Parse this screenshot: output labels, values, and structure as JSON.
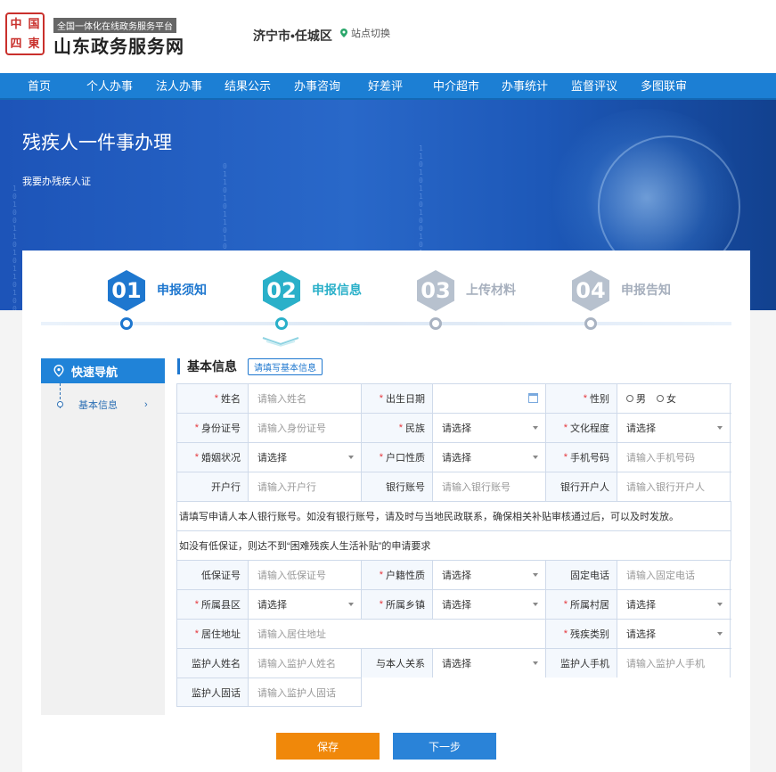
{
  "header": {
    "seal_chars": [
      "中",
      "国",
      "四",
      "東"
    ],
    "platform_label": "全国一体化在线政务服务平台",
    "site_title": "山东政务服务网",
    "region": "济宁市•任城区",
    "switch_label": "站点切换"
  },
  "nav": [
    "首页",
    "个人办事",
    "法人办事",
    "结果公示",
    "办事咨询",
    "好差评",
    "中介超市",
    "办事统计",
    "监督评议",
    "多图联审"
  ],
  "banner": {
    "title": "残疾人一件事办理",
    "subtitle": "我要办残疾人证"
  },
  "steps": [
    {
      "num": "01",
      "label": "申报须知",
      "state": "done",
      "color": "#1e77cf"
    },
    {
      "num": "02",
      "label": "申报信息",
      "state": "active",
      "color": "#2ab0c9"
    },
    {
      "num": "03",
      "label": "上传材料",
      "state": "todo",
      "color": "#b7c1ce"
    },
    {
      "num": "04",
      "label": "申报告知",
      "state": "todo",
      "color": "#b7c1ce"
    }
  ],
  "sidebar": {
    "title": "快速导航",
    "item": "基本信息"
  },
  "section": {
    "title": "基本信息",
    "tag": "请填写基本信息"
  },
  "form": {
    "name": {
      "label": "姓名",
      "placeholder": "请输入姓名"
    },
    "birth": {
      "label": "出生日期"
    },
    "gender": {
      "label": "性别",
      "male": "男",
      "female": "女"
    },
    "idcard": {
      "label": "身份证号",
      "placeholder": "请输入身份证号"
    },
    "ethnic": {
      "label": "民族",
      "value": "请选择"
    },
    "education": {
      "label": "文化程度",
      "value": "请选择"
    },
    "marriage": {
      "label": "婚姻状况",
      "value": "请选择"
    },
    "hukou": {
      "label": "户口性质",
      "value": "请选择"
    },
    "phone": {
      "label": "手机号码",
      "placeholder": "请输入手机号码"
    },
    "bank": {
      "label": "开户行",
      "placeholder": "请输入开户行"
    },
    "account": {
      "label": "银行账号",
      "placeholder": "请输入银行账号"
    },
    "account_holder": {
      "label": "银行开户人",
      "placeholder": "请输入银行开户人"
    },
    "note1": "请填写申请人本人银行账号。如没有银行账号，请及时与当地民政联系，确保相关补贴审核通过后，可以及时发放。",
    "note2": "如没有低保证，则达不到“困难残疾人生活补贴”的申请要求",
    "dibao": {
      "label": "低保证号",
      "placeholder": "请输入低保证号"
    },
    "huji": {
      "label": "户籍性质",
      "value": "请选择"
    },
    "tel": {
      "label": "固定电话",
      "placeholder": "请输入固定电话"
    },
    "county": {
      "label": "所属县区",
      "value": "请选择"
    },
    "town": {
      "label": "所属乡镇",
      "value": "请选择"
    },
    "village": {
      "label": "所属村居",
      "value": "请选择"
    },
    "address": {
      "label": "居住地址",
      "placeholder": "请输入居住地址"
    },
    "disability": {
      "label": "残疾类别",
      "value": "请选择"
    },
    "guardian_name": {
      "label": "监护人姓名",
      "placeholder": "请输入监护人姓名"
    },
    "relation": {
      "label": "与本人关系",
      "value": "请选择"
    },
    "guardian_phone": {
      "label": "监护人手机",
      "placeholder": "请输入监护人手机"
    },
    "guardian_tel": {
      "label": "监护人固话",
      "placeholder": "请输入监护人固话"
    }
  },
  "buttons": {
    "save": "保存",
    "next": "下一步"
  },
  "colors": {
    "primary": "#1e77cf",
    "nav": "#1c7fd4",
    "save": "#f0880a",
    "next": "#2a83d8",
    "required": "#e5363b"
  }
}
